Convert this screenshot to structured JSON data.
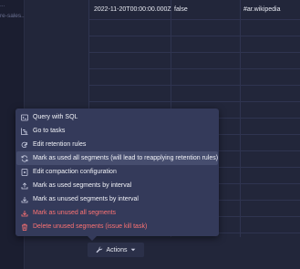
{
  "sidebar": {
    "texts": [
      "...",
      "re-sales..."
    ]
  },
  "table": {
    "first_row": {
      "time": "2022-11-20T00:00:00.000Z",
      "flag": "false",
      "channel": "#ar.wikipedia"
    }
  },
  "menu": {
    "items": [
      {
        "label": "Query with SQL",
        "icon": "console-icon"
      },
      {
        "label": "Go to tasks",
        "icon": "gantt-chart-icon"
      },
      {
        "label": "Edit retention rules",
        "icon": "automatic-updates-icon"
      },
      {
        "label": "Mark as used all segments (will lead to reapplying retention rules)",
        "icon": "refresh-icon"
      },
      {
        "label": "Edit compaction configuration",
        "icon": "compressed-icon"
      },
      {
        "label": "Mark as used segments by interval",
        "icon": "export-icon"
      },
      {
        "label": "Mark as unused segments by interval",
        "icon": "import-icon"
      },
      {
        "label": "Mark as unused all segments",
        "icon": "import-icon"
      },
      {
        "label": "Delete unused segments (issue kill task)",
        "icon": "trash-icon"
      }
    ]
  },
  "actions": {
    "label": "Actions"
  },
  "colors": {
    "danger": "#ff7373",
    "menu_bg": "#343a5a",
    "highlight": "#464d6e"
  }
}
